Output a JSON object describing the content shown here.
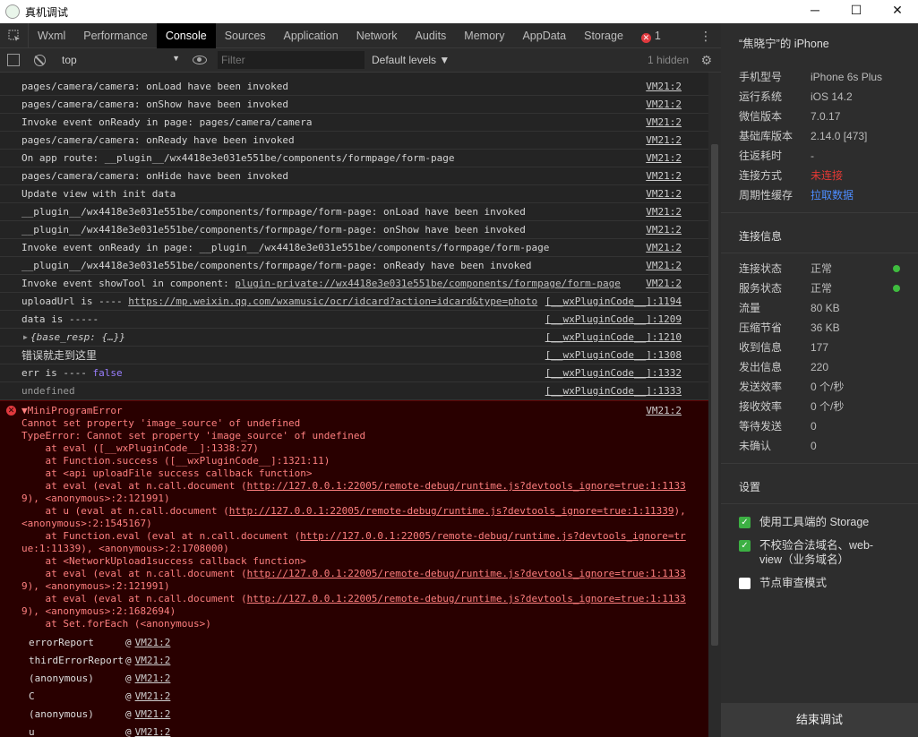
{
  "window": {
    "title": "真机调试",
    "minimize": "─",
    "maximize": "☐",
    "close": "✕"
  },
  "tabs": [
    {
      "label": "Wxml"
    },
    {
      "label": "Performance"
    },
    {
      "label": "Console"
    },
    {
      "label": "Sources"
    },
    {
      "label": "Application"
    },
    {
      "label": "Network"
    },
    {
      "label": "Audits"
    },
    {
      "label": "Memory"
    },
    {
      "label": "AppData"
    },
    {
      "label": "Storage"
    }
  ],
  "error_count": "1",
  "error_glyph": "✕",
  "kebab": "⋮",
  "toolbar": {
    "context": "top",
    "context_arrow": "▼",
    "filter_placeholder": "Filter",
    "levels": "Default levels ▼",
    "hidden": "1 hidden",
    "gear": "⚙"
  },
  "logs": [
    {
      "text": "pages/camera/camera: onLoad have been invoked",
      "src": "VM21:2"
    },
    {
      "text": "pages/camera/camera: onShow have been invoked",
      "src": "VM21:2"
    },
    {
      "text": "Invoke event onReady in page: pages/camera/camera",
      "src": "VM21:2"
    },
    {
      "text": "pages/camera/camera: onReady have been invoked",
      "src": "VM21:2"
    },
    {
      "text": "On app route: __plugin__/wx4418e3e031e551be/components/formpage/form-page",
      "src": "VM21:2"
    },
    {
      "text": "pages/camera/camera: onHide have been invoked",
      "src": "VM21:2"
    },
    {
      "text": "Update view with init data",
      "src": "VM21:2"
    },
    {
      "text": "__plugin__/wx4418e3e031e551be/components/formpage/form-page: onLoad have been invoked",
      "src": "VM21:2"
    },
    {
      "text": "__plugin__/wx4418e3e031e551be/components/formpage/form-page: onShow have been invoked",
      "src": "VM21:2"
    },
    {
      "text": "Invoke event onReady in page: __plugin__/wx4418e3e031e551be/components/formpage/form-page",
      "src": "VM21:2"
    },
    {
      "text": "__plugin__/wx4418e3e031e551be/components/formpage/form-page: onReady have been invoked",
      "src": "VM21:2"
    }
  ],
  "showtool": {
    "text": "Invoke event showTool in component: ",
    "link": "plugin-private://wx4418e3e031e551be/components/formpage/form-page",
    "src": "VM21:2"
  },
  "upload": {
    "text": "uploadUrl is ---- ",
    "link": "https://mp.weixin.qq.com/wxamusic/ocr/idcard?action=idcard&type=photo",
    "src": "[__wxPluginCode__]:1194"
  },
  "data_is": {
    "text": "data is -----",
    "src": "[__wxPluginCode__]:1209"
  },
  "obj": {
    "tri": "▶",
    "text": "{base_resp: {…}}",
    "src": "[__wxPluginCode__]:1210"
  },
  "cjk": {
    "text": "错误就走到这里",
    "src": "[__wxPluginCode__]:1308"
  },
  "err_is": {
    "text": "err is ---- ",
    "kw": "false",
    "src": "[__wxPluginCode__]:1332"
  },
  "undef": {
    "text": "undefined",
    "src": "[__wxPluginCode__]:1333"
  },
  "error": {
    "src": "VM21:2",
    "lines": [
      "▼MiniProgramError",
      "Cannot set property 'image_source' of undefined",
      "TypeError: Cannot set property 'image_source' of undefined",
      "    at eval ([__wxPluginCode__]:1338:27)",
      "    at Function.success ([__wxPluginCode__]:1321:11)",
      "    at <api uploadFile success callback function>"
    ],
    "s1_pre": "    at eval (eval at n.call.document (",
    "s1_link": "http://127.0.0.1:22005/remote-debug/runtime.js?devtools_ignore=true:1:1133",
    "s1_cont": "9",
    "s1_post": "), <anonymous>:2:121991)",
    "s2_pre": "    at u (eval at n.call.document (",
    "s2_link": "http://127.0.0.1:22005/remote-debug/runtime.js?devtools_ignore=true:1:11339",
    "s2_post": "),",
    "s2_post2": "<anonymous>:2:1545167)",
    "s3_pre": "    at Function.eval (eval at n.call.document (",
    "s3_link": "http://127.0.0.1:22005/remote-debug/runtime.js?devtools_ignore=tr",
    "s3_cont": "ue:1:11339",
    "s3_post": "), <anonymous>:2:1708000)",
    "s4": "    at <NetworkUpload1success callback function>",
    "s5_pre": "    at eval (eval at n.call.document (",
    "s5_link": "http://127.0.0.1:22005/remote-debug/runtime.js?devtools_ignore=true:1:1133",
    "s5_cont": "9",
    "s5_post": "), <anonymous>:2:121991)",
    "s6_pre": "    at eval (eval at n.call.document (",
    "s6_link": "http://127.0.0.1:22005/remote-debug/runtime.js?devtools_ignore=true:1:1133",
    "s6_cont": "9",
    "s6_post": "), <anonymous>:2:1682694)",
    "s7": "    at Set.forEach (<anonymous>)",
    "stack": [
      {
        "fn": "errorReport",
        "src": "VM21:2"
      },
      {
        "fn": "thirdErrorReport",
        "src": "VM21:2"
      },
      {
        "fn": "(anonymous)",
        "src": "VM21:2"
      },
      {
        "fn": "C",
        "src": "VM21:2"
      },
      {
        "fn": "(anonymous)",
        "src": "VM21:2"
      },
      {
        "fn": "u",
        "src": "VM21:2"
      }
    ]
  },
  "side": {
    "device": "“焦晓宁”的 iPhone",
    "info": [
      {
        "k": "手机型号",
        "v": "iPhone 6s Plus"
      },
      {
        "k": "运行系统",
        "v": "iOS 14.2"
      },
      {
        "k": "微信版本",
        "v": "7.0.17"
      },
      {
        "k": "基础库版本",
        "v": "2.14.0 [473]"
      },
      {
        "k": "往返耗时",
        "v": "-"
      },
      {
        "k": "连接方式",
        "v": "未连接"
      },
      {
        "k": "周期性缓存",
        "v": "拉取数据"
      }
    ],
    "conn_header": "连接信息",
    "conn": [
      {
        "k": "连接状态",
        "v": "正常"
      },
      {
        "k": "服务状态",
        "v": "正常"
      },
      {
        "k": "流量",
        "v": "80 KB"
      },
      {
        "k": "压缩节省",
        "v": "36 KB"
      },
      {
        "k": "收到信息",
        "v": "177"
      },
      {
        "k": "发出信息",
        "v": "220"
      },
      {
        "k": "发送效率",
        "v": "0 个/秒"
      },
      {
        "k": "接收效率",
        "v": "0 个/秒"
      },
      {
        "k": "等待发送",
        "v": "0"
      },
      {
        "k": "未确认",
        "v": "0"
      }
    ],
    "settings_header": "设置",
    "settings": [
      {
        "label": "使用工具端的 Storage",
        "checked": true
      },
      {
        "label": "不校验合法域名、web-view（业务域名）",
        "checked": true
      },
      {
        "label": "节点审查模式",
        "checked": false
      }
    ],
    "check_glyph": "✓",
    "end_button": "结束调试"
  },
  "colors": {
    "accent_green": "#3cb043",
    "error_red": "#e53935",
    "link_blue": "#4d8dff",
    "error_bg": "#290000"
  }
}
